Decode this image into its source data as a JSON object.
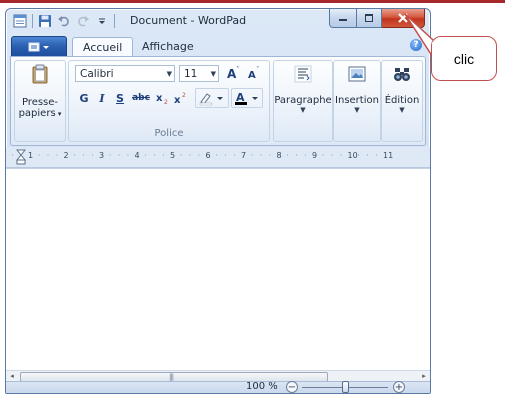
{
  "window": {
    "title": "Document - WordPad",
    "buttons": {
      "minimize": "minimize",
      "maximize": "maximize",
      "close": "close"
    }
  },
  "ribbon": {
    "tabs": [
      {
        "label": "Accueil",
        "active": true
      },
      {
        "label": "Affichage",
        "active": false
      }
    ],
    "clipboard": {
      "paste_label_line1": "Presse-",
      "paste_label_line2": "papiers"
    },
    "font": {
      "family": "Calibri",
      "size": "11",
      "group_label": "Police",
      "buttons": {
        "bold": "G",
        "italic": "I",
        "underline": "S",
        "strike": "abc"
      }
    },
    "paragraph_label": "Paragraphe",
    "insert_label": "Insertion",
    "edit_label": "Édition"
  },
  "ruler": {
    "ticks": [
      "1",
      "2",
      "3",
      "4",
      "5",
      "6",
      "7",
      "8",
      "9",
      "10",
      "11"
    ]
  },
  "status": {
    "zoom_text": "100 %",
    "zoom_minus": "−",
    "zoom_plus": "+",
    "zoom_level_percent": 100
  },
  "callout": {
    "text": "clic"
  },
  "colors": {
    "accent_red": "#c0504d",
    "ribbon_blue": "#2b5fb0"
  }
}
